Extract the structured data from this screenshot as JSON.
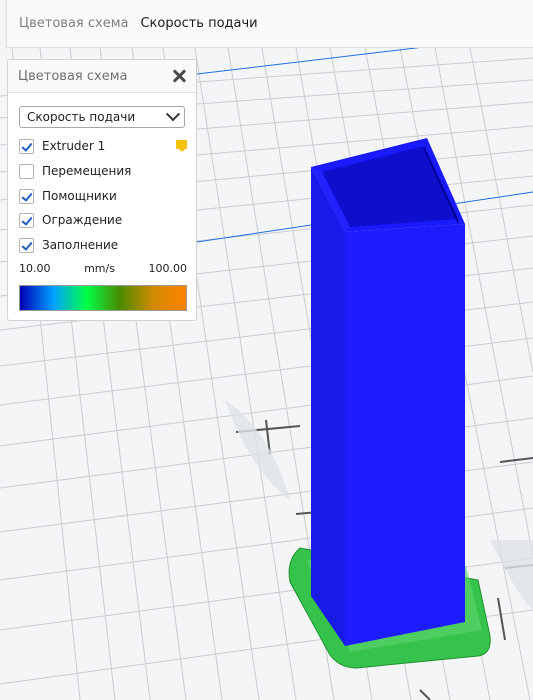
{
  "topbar": {
    "label": "Цветовая схема",
    "value": "Скорость подачи"
  },
  "panel": {
    "title": "Цветовая схема",
    "select_value": "Скорость подачи",
    "options": [
      {
        "label": "Extruder 1",
        "checked": true,
        "swatch_color": "#f4c20d"
      },
      {
        "label": "Перемещения",
        "checked": false
      },
      {
        "label": "Помощники",
        "checked": true
      },
      {
        "label": "Ограждение",
        "checked": true
      },
      {
        "label": "Заполнение",
        "checked": true
      }
    ],
    "legend": {
      "min": "10.00",
      "unit": "mm/s",
      "max": "100.00",
      "gradient_colors": [
        "#0000b4",
        "#00a0ff",
        "#00ff46",
        "#4a8c00",
        "#d08a00",
        "#ff8200"
      ]
    }
  },
  "scene": {
    "model_color": "#1a1aff",
    "skirt_color": "#34c049",
    "grid_color": "#c8ccd2",
    "axis_color": "#1e6fe0"
  }
}
